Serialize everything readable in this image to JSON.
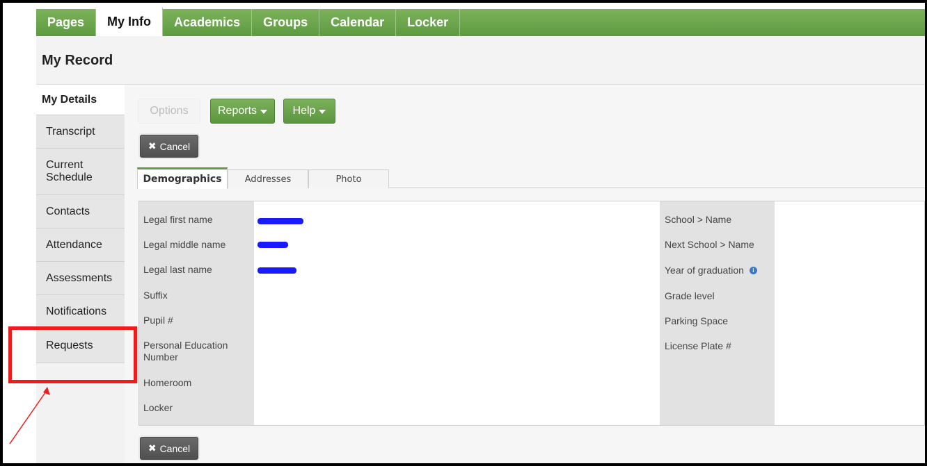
{
  "topnav": {
    "tabs": [
      {
        "label": "Pages"
      },
      {
        "label": "My Info",
        "active": true
      },
      {
        "label": "Academics"
      },
      {
        "label": "Groups"
      },
      {
        "label": "Calendar"
      },
      {
        "label": "Locker"
      }
    ]
  },
  "page": {
    "title": "My Record"
  },
  "sidenav": {
    "items": [
      {
        "label": "My Details",
        "active": true
      },
      {
        "label": "Transcript"
      },
      {
        "label": "Current Schedule"
      },
      {
        "label": "Contacts"
      },
      {
        "label": "Attendance"
      },
      {
        "label": "Assessments"
      },
      {
        "label": "Notifications"
      },
      {
        "label": "Requests"
      }
    ]
  },
  "toolbar": {
    "options_label": "Options",
    "reports_label": "Reports",
    "help_label": "Help",
    "cancel_label": "Cancel"
  },
  "subtabs": [
    {
      "label": "Demographics",
      "active": true
    },
    {
      "label": "Addresses"
    },
    {
      "label": "Photo"
    }
  ],
  "form": {
    "left_labels": [
      "Legal first name",
      "Legal middle name",
      "Legal last name",
      "Suffix",
      "Pupil #",
      "Personal Education Number",
      "Homeroom",
      "Locker"
    ],
    "right_labels": [
      "School > Name",
      "Next School > Name",
      "Year of graduation",
      "Grade level",
      "Parking Space",
      "License Plate #"
    ]
  },
  "colors": {
    "nav_green": "#5e9a41",
    "highlight_red": "#ee1c1c",
    "redaction_blue": "#1a1aff"
  },
  "icons": {
    "cancel": "x-icon",
    "dropdown": "caret-down-icon",
    "info": "info-icon"
  }
}
